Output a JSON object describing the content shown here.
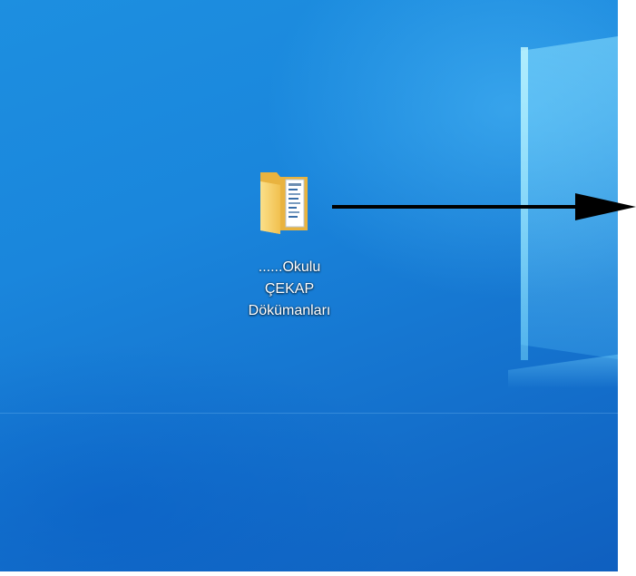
{
  "desktop": {
    "icon": {
      "icon_name": "folder-icon",
      "label_lines": [
        "......Okulu",
        "ÇEKAP",
        "Dökümanları"
      ]
    }
  },
  "colors": {
    "desktop_blue": "#1a86dc",
    "label_text": "#ffffff",
    "folder_yellow": "#f5c85a",
    "arrow": "#000000"
  }
}
